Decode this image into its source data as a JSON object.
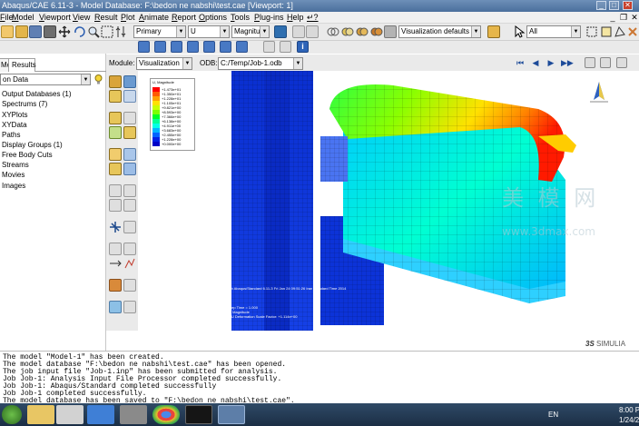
{
  "window": {
    "title": "Abaqus/CAE 6.11-3 - Model Database: F:\\bedon ne nabshi\\test.cae [Viewport: 1]",
    "minimize": "_",
    "maximize": "□",
    "close": "✕"
  },
  "menu": [
    "File",
    "Model",
    "Viewport",
    "View",
    "Result",
    "Plot",
    "Animate",
    "Report",
    "Options",
    "Tools",
    "Plug-ins",
    "Help",
    "↵?"
  ],
  "toolbar": {
    "primary": "Primary",
    "variable": "U",
    "invariant": "Magnitude",
    "vis_defaults": "Visualization defaults",
    "selection": "All"
  },
  "left_panel": {
    "tabs": [
      "Model",
      "Results"
    ],
    "active_tab": "Results",
    "context": "on Data",
    "tree": [
      "Output Databases (1)",
      "Spectrums (7)",
      "XYPlots",
      "XYData",
      "Paths",
      "Display Groups (1)",
      "Free Body Cuts",
      "Streams",
      "Movies",
      "Images"
    ]
  },
  "module_bar": {
    "module_label": "Module:",
    "module_value": "Visualization",
    "odb_label": "ODB:",
    "odb_value": "C:/Temp/Job-1.odb"
  },
  "viewport": {
    "legend_title": "U, Magnitude",
    "legend_values": [
      "+1.473e+01",
      "+1.350e+01",
      "+1.228e+01",
      "+1.105e+01",
      "+9.821e+00",
      "+8.593e+00",
      "+7.366e+00",
      "+6.138e+00",
      "+4.911e+00",
      "+3.683e+00",
      "+2.455e+00",
      "+1.228e+00",
      "+0.000e+00"
    ],
    "legend_colors": [
      "#ff0000",
      "#ff5a00",
      "#ffa000",
      "#ffe100",
      "#c8ff00",
      "#7dff00",
      "#00ff28",
      "#00ff96",
      "#00ffe6",
      "#00b4ff",
      "#0064ff",
      "#0020e6",
      "#0000c8"
    ],
    "odb_info": "ODB: Job-1.odb    Abaqus/Standard 6.11-3    Fri Jan 24 09:51:26 Iran Standard Time 2014",
    "step_info": "Step: Step-1",
    "increment_info": "Increment    1: Step Time =    1.000",
    "primary_var": "Primary Var: U, Magnitude",
    "deformed_var": "Deformed Var: U   Deformation Scale Factor: +1.114e+00",
    "watermark_cn": "美 模 网",
    "watermark_url": "www.3dmax.com",
    "simulia": "SIMULIA"
  },
  "messages": [
    "The model \"Model-1\" has been created.",
    "The model database \"F:\\bedon ne nabshi\\test.cae\" has been opened.",
    "The job input file \"Job-1.inp\" has been submitted for analysis.",
    "Job Job-1: Analysis Input File Processor completed successfully.",
    "Job Job-1: Abaqus/Standard completed successfully",
    "Job Job-1 completed successfully.",
    "The model database has been saved to \"F:\\bedon ne nabshi\\test.cae\"."
  ],
  "taskbar": {
    "lang": "EN",
    "time": "8:00 P",
    "date": "1/24/2"
  }
}
